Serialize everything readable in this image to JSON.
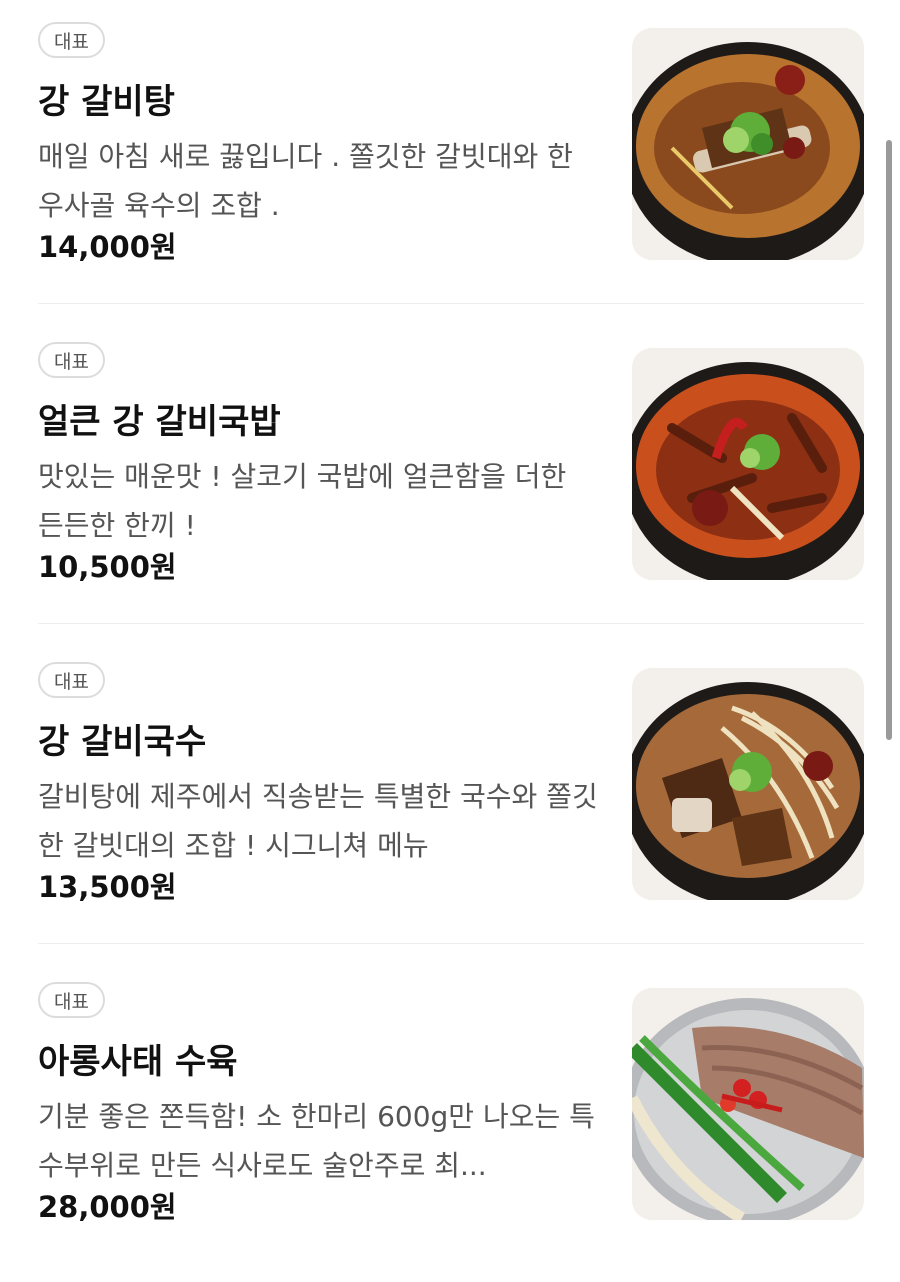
{
  "menu": {
    "items": [
      {
        "badge": "대표",
        "name": "강 갈비탕",
        "description": "매일 아침 새로 끓입니다 . 쫄깃한 갈빗대와 한우사골 육수의 조합 .",
        "price": "14,000원",
        "image_icon": "galbitang-bowl-image"
      },
      {
        "badge": "대표",
        "name": "얼큰 강 갈비국밥",
        "description": "맛있는 매운맛 ! 살코기 국밥에 얼큰함을 더한 든든한 한끼 !",
        "price": "10,500원",
        "image_icon": "spicy-gukbap-bowl-image"
      },
      {
        "badge": "대표",
        "name": "강 갈비국수",
        "description": "갈비탕에 제주에서 직송받는 특별한 국수와 쫄깃한 갈빗대의 조합 ! 시그니쳐 메뉴",
        "price": "13,500원",
        "image_icon": "galbi-noodle-bowl-image"
      },
      {
        "badge": "대표",
        "name": "아롱사태 수육",
        "description": "기분 좋은 쫀득함! 소 한마리 600g만 나오는 특수부위로 만든 식사로도 술안주로 최...",
        "price": "28,000원",
        "image_icon": "suyuk-platter-image"
      }
    ]
  },
  "colors": {
    "text_primary": "#111111",
    "text_secondary": "#555555",
    "badge_border": "#dcdcdc",
    "divider": "#eeeeee"
  }
}
